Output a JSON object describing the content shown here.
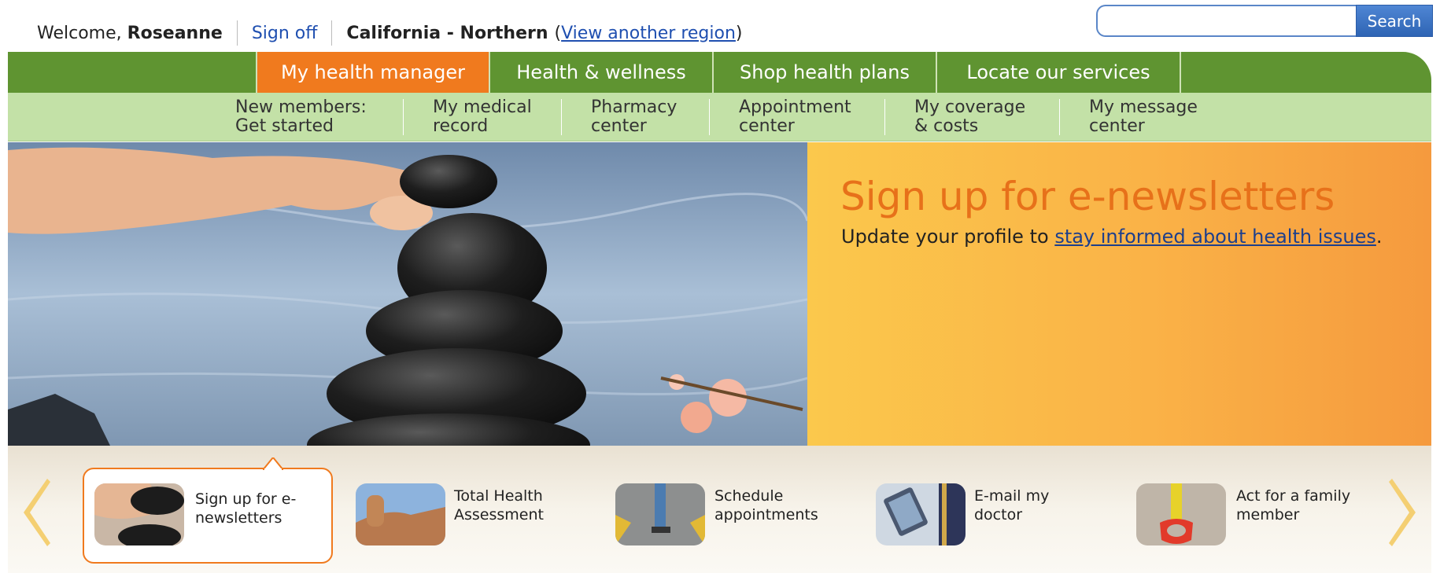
{
  "header": {
    "welcome_prefix": "Welcome,",
    "user_name": "Roseanne",
    "sign_off": "Sign off",
    "region": "California - Northern",
    "region_link": "View another region",
    "search_button": "Search",
    "search_value": ""
  },
  "main_nav": [
    {
      "label": "My health manager",
      "active": true
    },
    {
      "label": "Health & wellness",
      "active": false
    },
    {
      "label": "Shop health plans",
      "active": false
    },
    {
      "label": "Locate our services",
      "active": false
    }
  ],
  "sub_nav": [
    {
      "line1": "New members:",
      "line2": "Get started"
    },
    {
      "line1": "My medical",
      "line2": "record"
    },
    {
      "line1": "Pharmacy",
      "line2": "center"
    },
    {
      "line1": "Appointment",
      "line2": "center"
    },
    {
      "line1": "My coverage",
      "line2": "& costs"
    },
    {
      "line1": "My message",
      "line2": "center"
    }
  ],
  "promo": {
    "title": "Sign up for e-newsletters",
    "text_prefix": "Update your profile to ",
    "link": "stay informed about health issues",
    "text_suffix": "."
  },
  "carousel": {
    "items": [
      {
        "line1": "Sign up for e-",
        "line2": "newsletters",
        "active": true,
        "icon": "stones-thumbnail"
      },
      {
        "line1": "Total Health",
        "line2": "Assessment",
        "active": false,
        "icon": "thumbs-up-thumbnail"
      },
      {
        "line1": "Schedule",
        "line2": "appointments",
        "active": false,
        "icon": "walking-person-thumbnail"
      },
      {
        "line1": "E-mail my",
        "line2": "doctor",
        "active": false,
        "icon": "tablet-device-thumbnail"
      },
      {
        "line1": "Act for a family",
        "line2": "member",
        "active": false,
        "icon": "toy-shovel-thumbnail"
      }
    ]
  },
  "colors": {
    "nav_green": "#5f9431",
    "subnav_green": "#c3e1a7",
    "accent_orange": "#f07a1e",
    "link_blue": "#1f4fb0"
  }
}
